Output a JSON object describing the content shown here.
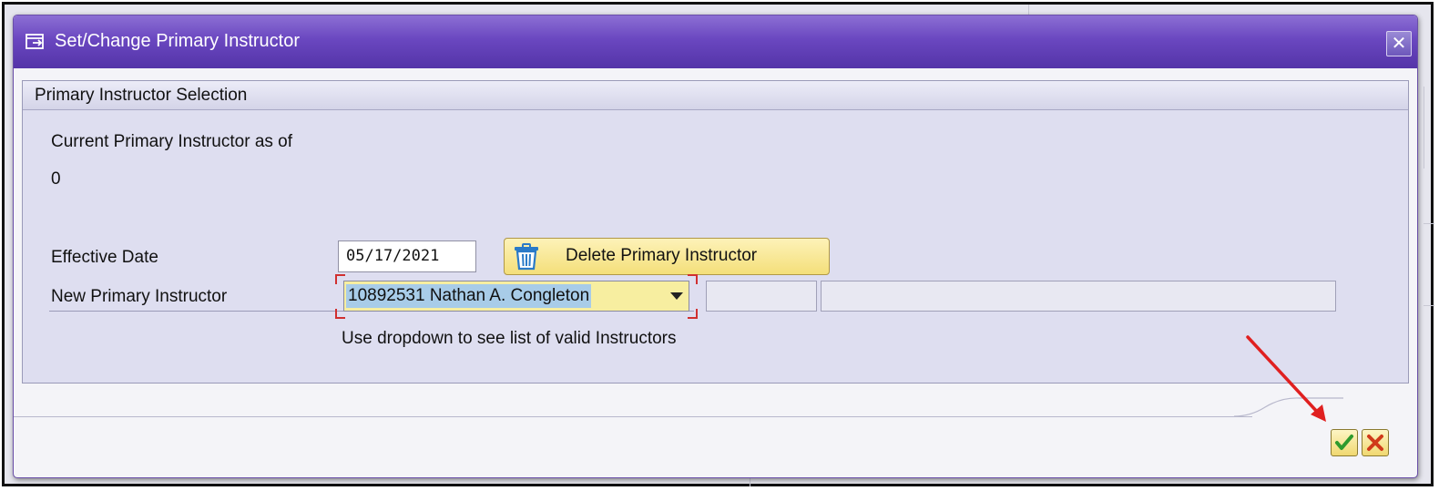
{
  "dialog": {
    "title": "Set/Change Primary Instructor",
    "close_icon": "close-icon"
  },
  "group": {
    "title": "Primary Instructor Selection",
    "current_label": "Current Primary Instructor as of",
    "current_value": "0"
  },
  "form": {
    "effective_date_label": "Effective Date",
    "effective_date_value": "05/17/2021",
    "delete_button_label": "Delete Primary Instructor",
    "delete_button_icon": "trash-icon",
    "new_instructor_label": "New Primary Instructor",
    "new_instructor_value": "10892531 Nathan A. Congleton",
    "hint": "Use dropdown to see list of valid Instructors"
  },
  "footer": {
    "confirm_icon": "checkmark-icon",
    "cancel_icon": "cancel-x-icon"
  },
  "colors": {
    "titlebar": "#6a47c0",
    "group_background": "#dedef0",
    "button_yellow": "#f4df7a",
    "combo_selection": "#a8cce8",
    "annotation_arrow": "#e02020"
  }
}
